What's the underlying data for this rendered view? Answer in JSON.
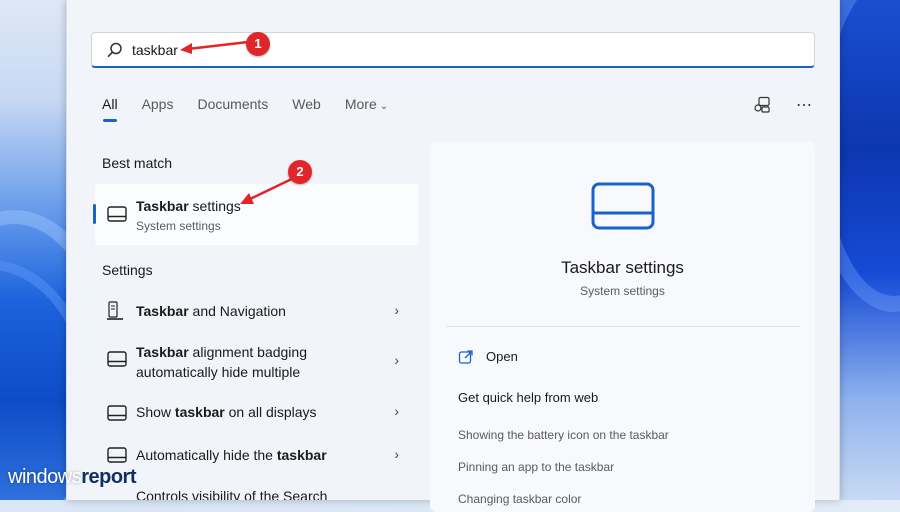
{
  "search": {
    "value": "taskbar",
    "icon": "search-icon"
  },
  "tabs": [
    {
      "label": "All",
      "active": true
    },
    {
      "label": "Apps"
    },
    {
      "label": "Documents"
    },
    {
      "label": "Web"
    },
    {
      "label": "More"
    }
  ],
  "sections": {
    "best_match": "Best match",
    "settings": "Settings"
  },
  "best_match": {
    "title": "Taskbar settings",
    "title_bold": "Taskbar",
    "title_rest": " settings",
    "subtitle": "System settings"
  },
  "settings_results": [
    {
      "pre": "",
      "bold": "Taskbar",
      "post": " and Navigation"
    },
    {
      "pre": "",
      "bold": "Taskbar",
      "post": " alignment badging",
      "line2": "automatically hide multiple"
    },
    {
      "pre": "Show ",
      "bold": "taskbar",
      "post": " on all displays"
    },
    {
      "pre": "Automatically hide the ",
      "bold": "taskbar",
      "post": ""
    },
    {
      "pre": "Controls visibility of the Search",
      "bold": "",
      "post": ""
    }
  ],
  "preview": {
    "title": "Taskbar settings",
    "subtitle": "System settings",
    "open_label": "Open",
    "help_heading": "Get quick help from web",
    "links": [
      "Showing the battery icon on the taskbar",
      "Pinning an app to the taskbar",
      "Changing taskbar color"
    ]
  },
  "callouts": [
    "1",
    "2"
  ],
  "watermark": {
    "light": "windows",
    "bold": "report"
  },
  "colors": {
    "accent": "#1b62c8",
    "callout": "#e0262a"
  }
}
